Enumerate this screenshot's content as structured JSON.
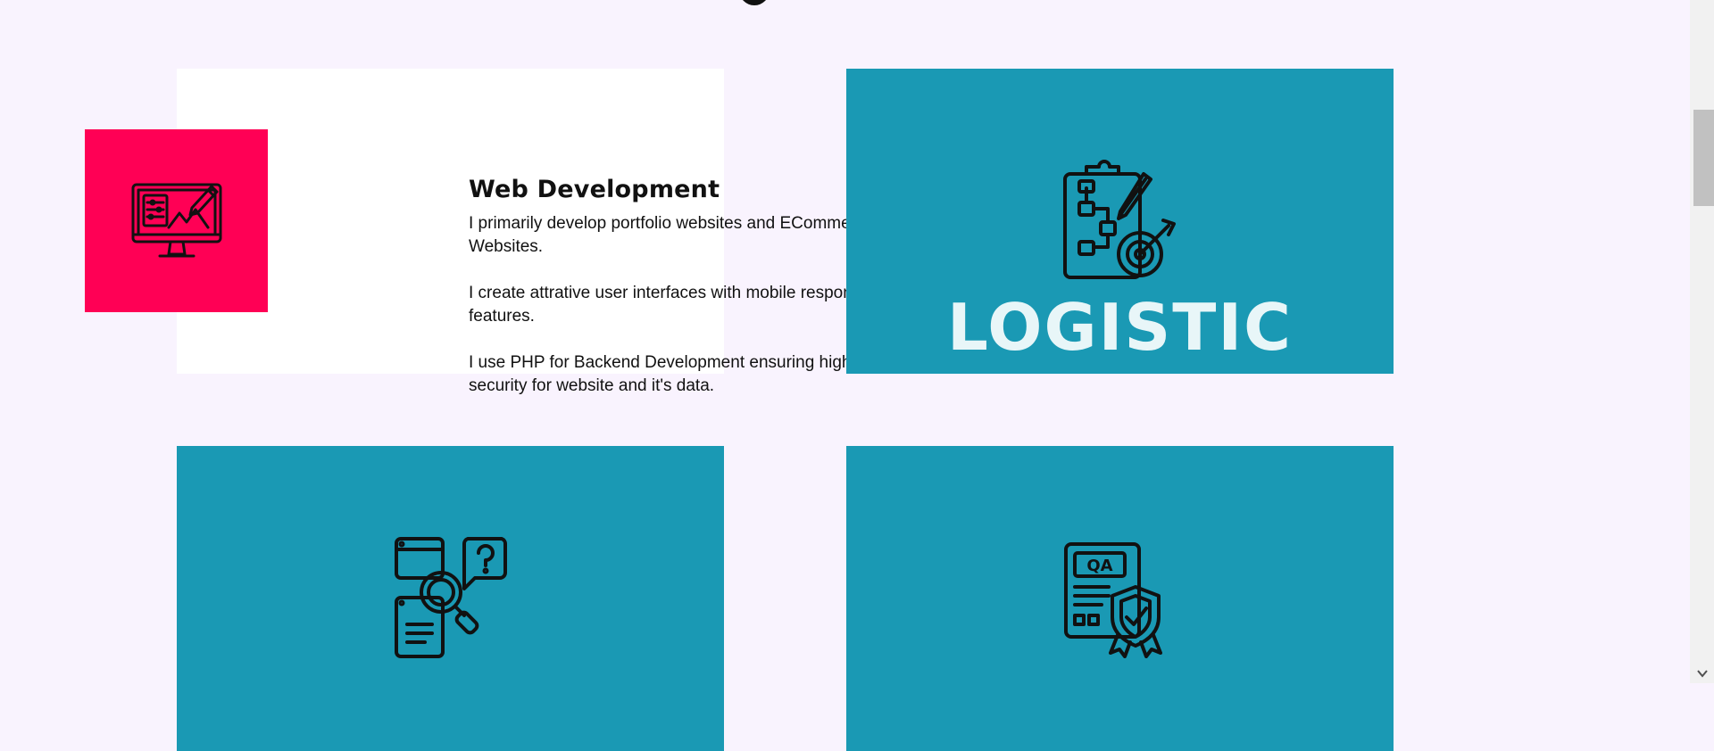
{
  "cards": {
    "web": {
      "title": "Web Development",
      "para1": "I primarily develop portfolio websites and ECommerce Websites.",
      "para2": "I create attrative user interfaces with mobile responding features.",
      "para3": "I use PHP for Backend Development ensuring highest security for website and it's data.",
      "icon": "monitor-design-icon"
    },
    "logistic": {
      "label": "LOGISTIC",
      "icon": "clipboard-target-icon"
    },
    "analysis": {
      "label": "",
      "icon": "research-magnifier-icon"
    },
    "qa": {
      "label": "",
      "icon": "qa-certificate-icon"
    }
  },
  "colors": {
    "background": "#f9f3fe",
    "accent_pink": "#ff0055",
    "teal": "#1a99b4",
    "label_text": "#e8f6f8"
  }
}
